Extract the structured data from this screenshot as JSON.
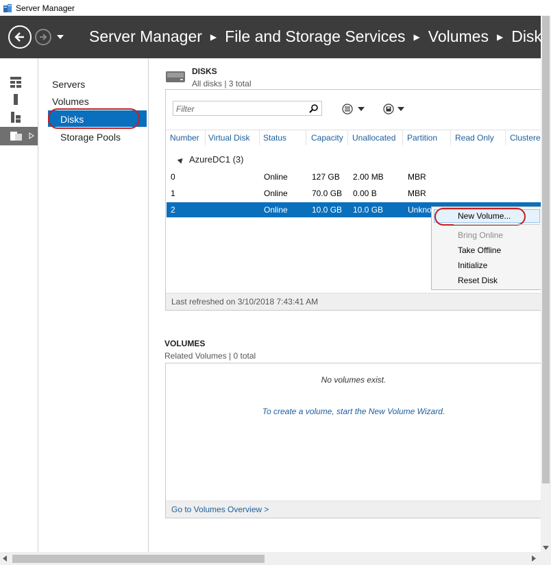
{
  "window": {
    "title": "Server Manager"
  },
  "breadcrumb": [
    "Server Manager",
    "File and Storage Services",
    "Volumes",
    "Disks"
  ],
  "nav": {
    "items": [
      "Servers",
      "Volumes",
      "Disks",
      "Storage Pools"
    ],
    "selected": "Disks"
  },
  "disks": {
    "title": "DISKS",
    "subtitle": "All disks | 3 total",
    "filter_placeholder": "Filter",
    "columns": [
      "Number",
      "Virtual Disk",
      "Status",
      "Capacity",
      "Unallocated",
      "Partition",
      "Read Only",
      "Clustered"
    ],
    "group_label": "AzureDC1 (3)",
    "rows": [
      {
        "number": "0",
        "virtual_disk": "",
        "status": "Online",
        "capacity": "127 GB",
        "unallocated": "2.00 MB",
        "partition": "MBR"
      },
      {
        "number": "1",
        "virtual_disk": "",
        "status": "Online",
        "capacity": "70.0 GB",
        "unallocated": "0.00 B",
        "partition": "MBR"
      },
      {
        "number": "2",
        "virtual_disk": "",
        "status": "Online",
        "capacity": "10.0 GB",
        "unallocated": "10.0 GB",
        "partition": "Unknown"
      }
    ],
    "selected_row": "2",
    "last_refreshed": "Last refreshed on 3/10/2018 7:43:41 AM"
  },
  "context_menu": {
    "items": [
      {
        "label": "New Volume...",
        "enabled": true
      },
      {
        "label": "Bring Online",
        "enabled": false
      },
      {
        "label": "Take Offline",
        "enabled": true
      },
      {
        "label": "Initialize",
        "enabled": true
      },
      {
        "label": "Reset Disk",
        "enabled": true
      }
    ]
  },
  "volumes": {
    "title": "VOLUMES",
    "subtitle": "Related Volumes | 0 total",
    "empty_message": "No volumes exist.",
    "wizard_link": "To create a volume, start the New Volume Wizard.",
    "overview_link": "Go to Volumes Overview >"
  },
  "colors": {
    "header_bg": "#3c3c3c",
    "selection": "#0a6fbd",
    "link": "#1b5d9c",
    "highlight_ring": "#c81e1e"
  }
}
